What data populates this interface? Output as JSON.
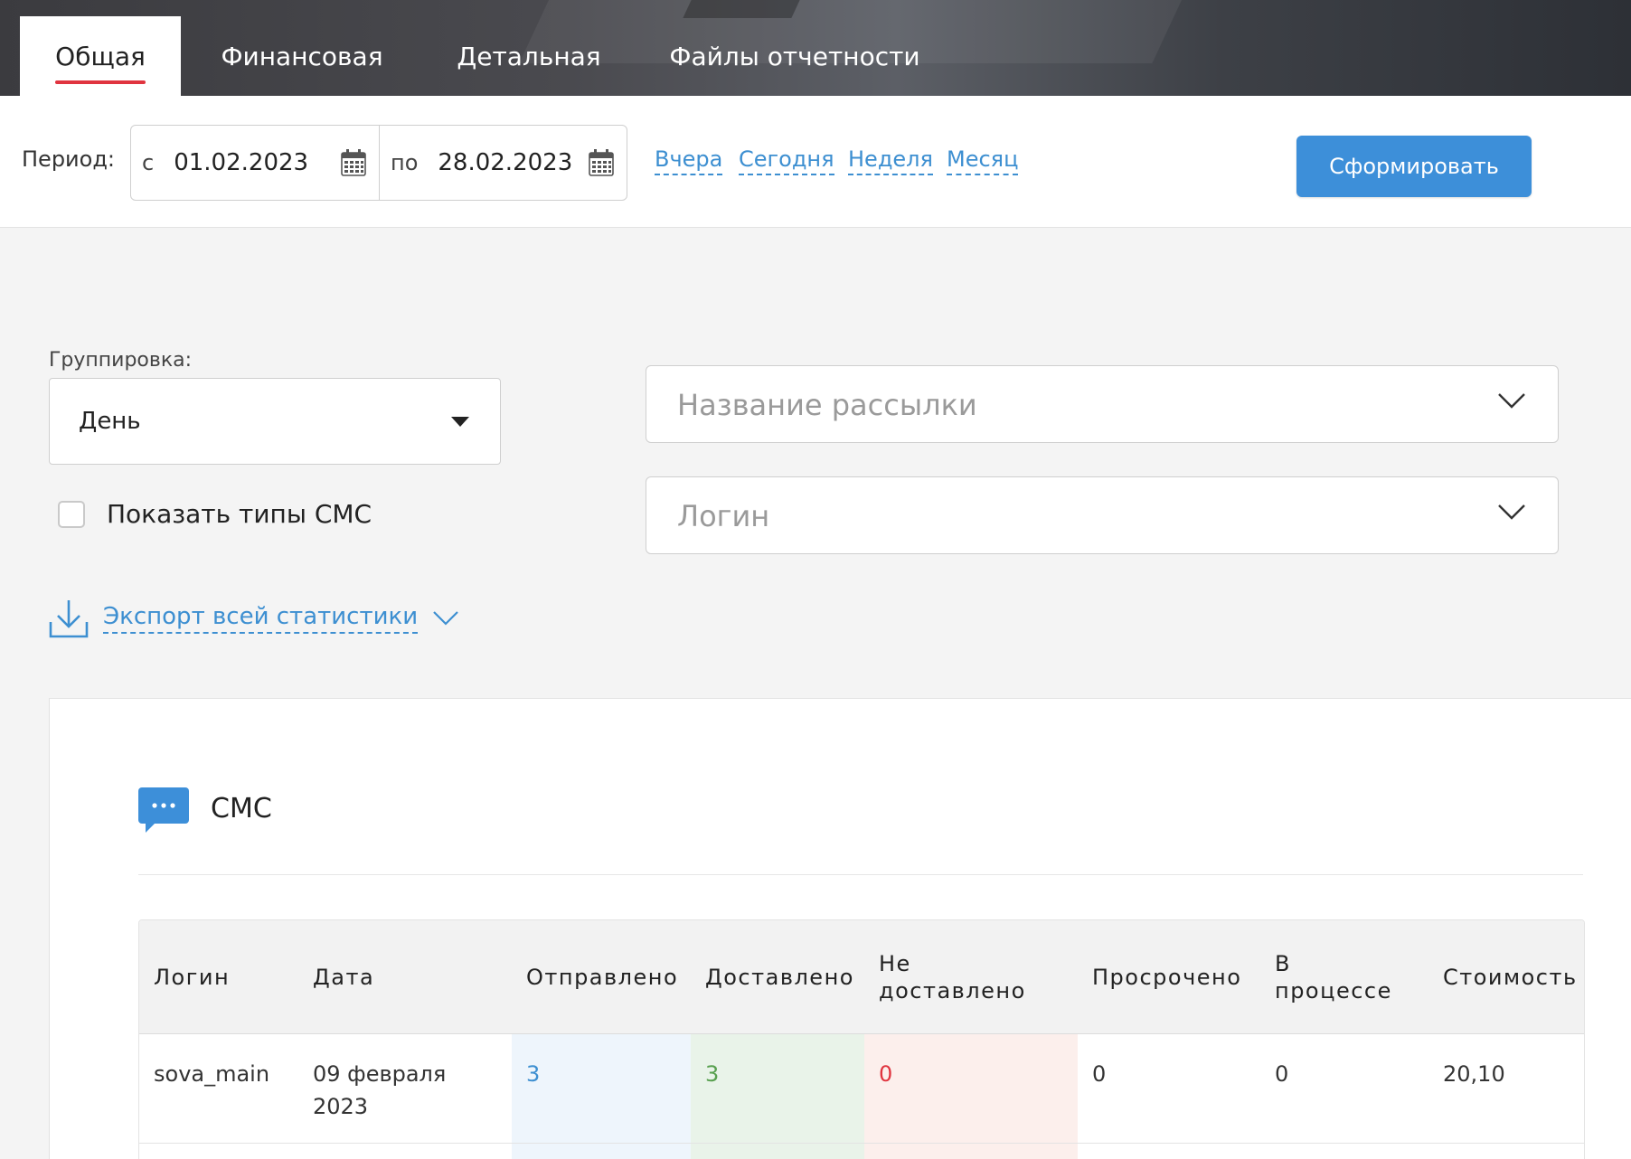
{
  "tabs": [
    {
      "label": "Общая",
      "active": true
    },
    {
      "label": "Финансовая"
    },
    {
      "label": "Детальная"
    },
    {
      "label": "Файлы отчетности"
    }
  ],
  "period": {
    "label": "Период:",
    "from_prefix": "с",
    "from_value": "01.02.2023",
    "to_prefix": "по",
    "to_value": "28.02.2023",
    "quick": [
      "Вчера",
      "Сегодня",
      "Неделя",
      "Месяц"
    ],
    "submit_label": "Сформировать"
  },
  "filters": {
    "grouping_label": "Группировка:",
    "grouping_value": "День",
    "show_types_label": "Показать типы СМС",
    "show_types_checked": false,
    "campaign_placeholder": "Название рассылки",
    "login_placeholder": "Логин",
    "export_label": "Экспорт всей статистики"
  },
  "card": {
    "title": "СМС",
    "columns": [
      "Логин",
      "Дата",
      "Отправлено",
      "Доставлено",
      "Не доставлено",
      "Просрочено",
      "В процессе",
      "Стоимость"
    ],
    "rows": [
      {
        "login": "sova_main",
        "date": "09 февраля 2023",
        "sent": "3",
        "delivered": "3",
        "undelivered": "0",
        "expired": "0",
        "in_progress": "0",
        "cost": "20,10"
      }
    ]
  },
  "colors": {
    "accent": "#3d8fd9",
    "tab_underline": "#e0343f",
    "sent": "#3d8fd1",
    "delivered": "#58a04f",
    "undelivered": "#e0343f"
  },
  "icons": [
    "calendar-icon",
    "chevron-down-icon",
    "download-icon",
    "chat-bubble-icon",
    "caret-down-icon"
  ]
}
